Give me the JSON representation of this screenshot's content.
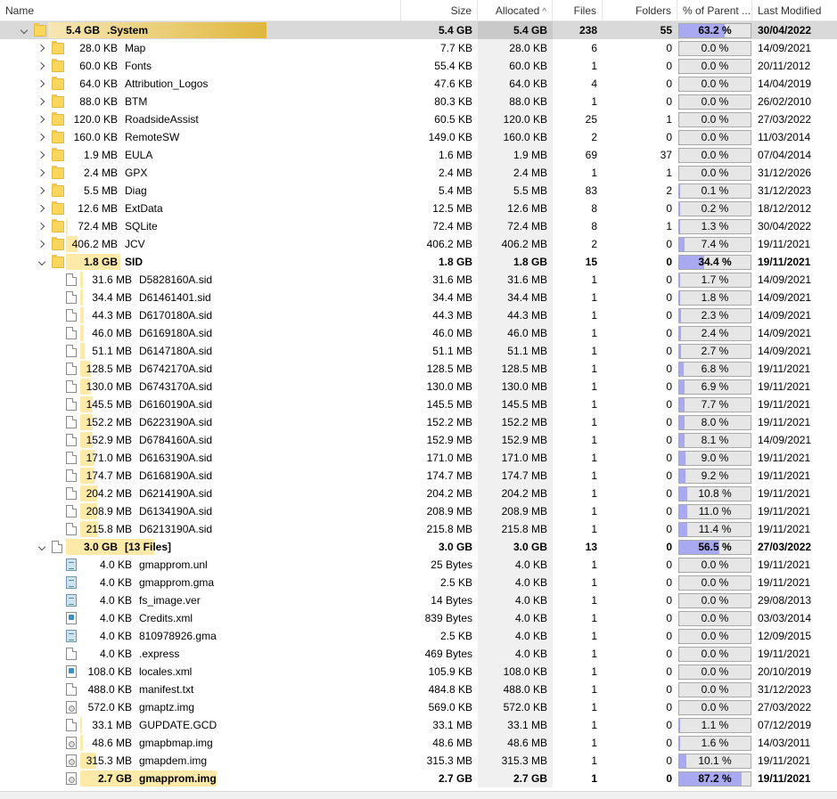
{
  "columns": {
    "name": "Name",
    "size": "Size",
    "allocated": "Allocated",
    "files": "Files",
    "folders": "Folders",
    "pct": "% of Parent ...",
    "modified": "Last Modified"
  },
  "rows": [
    {
      "depth": 0,
      "expander": "down",
      "icon": "folder-icon",
      "bar": "5.4 GB",
      "name": ".System",
      "size": "5.4 GB",
      "alloc": "5.4 GB",
      "files": "238",
      "folders": "55",
      "pct": "63.2 %",
      "pct_value": 63.2,
      "date": "30/04/2022",
      "bold": true,
      "selected": true
    },
    {
      "depth": 1,
      "expander": "right",
      "icon": "folder-icon",
      "bar": "28.0 KB",
      "name": "Map",
      "size": "7.7 KB",
      "alloc": "28.0 KB",
      "files": "6",
      "folders": "0",
      "pct": "0.0 %",
      "pct_value": 0,
      "date": "14/09/2021"
    },
    {
      "depth": 1,
      "expander": "right",
      "icon": "folder-icon",
      "bar": "60.0 KB",
      "name": "Fonts",
      "size": "55.4 KB",
      "alloc": "60.0 KB",
      "files": "1",
      "folders": "0",
      "pct": "0.0 %",
      "pct_value": 0,
      "date": "20/11/2012"
    },
    {
      "depth": 1,
      "expander": "right",
      "icon": "folder-icon",
      "bar": "64.0 KB",
      "name": "Attribution_Logos",
      "size": "47.6 KB",
      "alloc": "64.0 KB",
      "files": "4",
      "folders": "0",
      "pct": "0.0 %",
      "pct_value": 0,
      "date": "14/04/2019"
    },
    {
      "depth": 1,
      "expander": "right",
      "icon": "folder-icon",
      "bar": "88.0 KB",
      "name": "BTM",
      "size": "80.3 KB",
      "alloc": "88.0 KB",
      "files": "1",
      "folders": "0",
      "pct": "0.0 %",
      "pct_value": 0,
      "date": "26/02/2010"
    },
    {
      "depth": 1,
      "expander": "right",
      "icon": "folder-icon",
      "bar": "120.0 KB",
      "name": "RoadsideAssist",
      "size": "60.5 KB",
      "alloc": "120.0 KB",
      "files": "25",
      "folders": "1",
      "pct": "0.0 %",
      "pct_value": 0,
      "date": "27/03/2022"
    },
    {
      "depth": 1,
      "expander": "right",
      "icon": "folder-icon",
      "bar": "160.0 KB",
      "name": "RemoteSW",
      "size": "149.0 KB",
      "alloc": "160.0 KB",
      "files": "2",
      "folders": "0",
      "pct": "0.0 %",
      "pct_value": 0,
      "date": "11/03/2014"
    },
    {
      "depth": 1,
      "expander": "right",
      "icon": "folder-icon",
      "bar": "1.9 MB",
      "name": "EULA",
      "size": "1.6 MB",
      "alloc": "1.9 MB",
      "files": "69",
      "folders": "37",
      "pct": "0.0 %",
      "pct_value": 0,
      "date": "07/04/2014"
    },
    {
      "depth": 1,
      "expander": "right",
      "icon": "folder-icon",
      "bar": "2.4 MB",
      "name": "GPX",
      "size": "2.4 MB",
      "alloc": "2.4 MB",
      "files": "1",
      "folders": "1",
      "pct": "0.0 %",
      "pct_value": 0,
      "date": "31/12/2026"
    },
    {
      "depth": 1,
      "expander": "right",
      "icon": "folder-icon",
      "bar": "5.5 MB",
      "name": "Diag",
      "size": "5.4 MB",
      "alloc": "5.5 MB",
      "files": "83",
      "folders": "2",
      "pct": "0.1 %",
      "pct_value": 0.1,
      "date": "31/12/2023"
    },
    {
      "depth": 1,
      "expander": "right",
      "icon": "folder-icon",
      "bar": "12.6 MB",
      "name": "ExtData",
      "size": "12.5 MB",
      "alloc": "12.6 MB",
      "files": "8",
      "folders": "0",
      "pct": "0.2 %",
      "pct_value": 0.2,
      "date": "18/12/2012"
    },
    {
      "depth": 1,
      "expander": "right",
      "icon": "folder-icon",
      "bar": "72.4 MB",
      "name": "SQLite",
      "size": "72.4 MB",
      "alloc": "72.4 MB",
      "files": "8",
      "folders": "1",
      "pct": "1.3 %",
      "pct_value": 1.3,
      "date": "30/04/2022"
    },
    {
      "depth": 1,
      "expander": "right",
      "icon": "folder-icon",
      "bar": "406.2 MB",
      "name": "JCV",
      "size": "406.2 MB",
      "alloc": "406.2 MB",
      "files": "2",
      "folders": "0",
      "pct": "7.4 %",
      "pct_value": 7.4,
      "date": "19/11/2021"
    },
    {
      "depth": 1,
      "expander": "down",
      "icon": "folder-icon",
      "bar": "1.8 GB",
      "name": "SID",
      "size": "1.8 GB",
      "alloc": "1.8 GB",
      "files": "15",
      "folders": "0",
      "pct": "34.4 %",
      "pct_value": 34.4,
      "date": "19/11/2021",
      "bold": true
    },
    {
      "depth": 2,
      "icon": "file-icon",
      "bar": "31.6 MB",
      "name": "D5828160A.sid",
      "size": "31.6 MB",
      "alloc": "31.6 MB",
      "files": "1",
      "folders": "0",
      "pct": "1.7 %",
      "pct_value": 1.7,
      "date": "14/09/2021"
    },
    {
      "depth": 2,
      "icon": "file-icon",
      "bar": "34.4 MB",
      "name": "D61461401.sid",
      "size": "34.4 MB",
      "alloc": "34.4 MB",
      "files": "1",
      "folders": "0",
      "pct": "1.8 %",
      "pct_value": 1.8,
      "date": "14/09/2021"
    },
    {
      "depth": 2,
      "icon": "file-icon",
      "bar": "44.3 MB",
      "name": "D6170180A.sid",
      "size": "44.3 MB",
      "alloc": "44.3 MB",
      "files": "1",
      "folders": "0",
      "pct": "2.3 %",
      "pct_value": 2.3,
      "date": "14/09/2021"
    },
    {
      "depth": 2,
      "icon": "file-icon",
      "bar": "46.0 MB",
      "name": "D6169180A.sid",
      "size": "46.0 MB",
      "alloc": "46.0 MB",
      "files": "1",
      "folders": "0",
      "pct": "2.4 %",
      "pct_value": 2.4,
      "date": "14/09/2021"
    },
    {
      "depth": 2,
      "icon": "file-icon",
      "bar": "51.1 MB",
      "name": "D6147180A.sid",
      "size": "51.1 MB",
      "alloc": "51.1 MB",
      "files": "1",
      "folders": "0",
      "pct": "2.7 %",
      "pct_value": 2.7,
      "date": "14/09/2021"
    },
    {
      "depth": 2,
      "icon": "file-icon",
      "bar": "128.5 MB",
      "name": "D6742170A.sid",
      "size": "128.5 MB",
      "alloc": "128.5 MB",
      "files": "1",
      "folders": "0",
      "pct": "6.8 %",
      "pct_value": 6.8,
      "date": "19/11/2021"
    },
    {
      "depth": 2,
      "icon": "file-icon",
      "bar": "130.0 MB",
      "name": "D6743170A.sid",
      "size": "130.0 MB",
      "alloc": "130.0 MB",
      "files": "1",
      "folders": "0",
      "pct": "6.9 %",
      "pct_value": 6.9,
      "date": "19/11/2021"
    },
    {
      "depth": 2,
      "icon": "file-icon",
      "bar": "145.5 MB",
      "name": "D6160190A.sid",
      "size": "145.5 MB",
      "alloc": "145.5 MB",
      "files": "1",
      "folders": "0",
      "pct": "7.7 %",
      "pct_value": 7.7,
      "date": "19/11/2021"
    },
    {
      "depth": 2,
      "icon": "file-icon",
      "bar": "152.2 MB",
      "name": "D6223190A.sid",
      "size": "152.2 MB",
      "alloc": "152.2 MB",
      "files": "1",
      "folders": "0",
      "pct": "8.0 %",
      "pct_value": 8.0,
      "date": "19/11/2021"
    },
    {
      "depth": 2,
      "icon": "file-icon",
      "bar": "152.9 MB",
      "name": "D6784160A.sid",
      "size": "152.9 MB",
      "alloc": "152.9 MB",
      "files": "1",
      "folders": "0",
      "pct": "8.1 %",
      "pct_value": 8.1,
      "date": "14/09/2021"
    },
    {
      "depth": 2,
      "icon": "file-icon",
      "bar": "171.0 MB",
      "name": "D6163190A.sid",
      "size": "171.0 MB",
      "alloc": "171.0 MB",
      "files": "1",
      "folders": "0",
      "pct": "9.0 %",
      "pct_value": 9.0,
      "date": "19/11/2021"
    },
    {
      "depth": 2,
      "icon": "file-icon",
      "bar": "174.7 MB",
      "name": "D6168190A.sid",
      "size": "174.7 MB",
      "alloc": "174.7 MB",
      "files": "1",
      "folders": "0",
      "pct": "9.2 %",
      "pct_value": 9.2,
      "date": "19/11/2021"
    },
    {
      "depth": 2,
      "icon": "file-icon",
      "bar": "204.2 MB",
      "name": "D6214190A.sid",
      "size": "204.2 MB",
      "alloc": "204.2 MB",
      "files": "1",
      "folders": "0",
      "pct": "10.8 %",
      "pct_value": 10.8,
      "date": "19/11/2021"
    },
    {
      "depth": 2,
      "icon": "file-icon",
      "bar": "208.9 MB",
      "name": "D6134190A.sid",
      "size": "208.9 MB",
      "alloc": "208.9 MB",
      "files": "1",
      "folders": "0",
      "pct": "11.0 %",
      "pct_value": 11.0,
      "date": "19/11/2021"
    },
    {
      "depth": 2,
      "icon": "file-icon",
      "bar": "215.8 MB",
      "name": "D6213190A.sid",
      "size": "215.8 MB",
      "alloc": "215.8 MB",
      "files": "1",
      "folders": "0",
      "pct": "11.4 %",
      "pct_value": 11.4,
      "date": "19/11/2021"
    },
    {
      "depth": 1,
      "expander": "down",
      "icon": "file-icon",
      "bar": "3.0 GB",
      "name": "[13 Files]",
      "size": "3.0 GB",
      "alloc": "3.0 GB",
      "files": "13",
      "folders": "0",
      "pct": "56.5 %",
      "pct_value": 56.5,
      "date": "27/03/2022",
      "bold": true
    },
    {
      "depth": 2,
      "icon": "doc-icon",
      "bar": "4.0 KB",
      "name": "gmapprom.unl",
      "size": "25 Bytes",
      "alloc": "4.0 KB",
      "files": "1",
      "folders": "0",
      "pct": "0.0 %",
      "pct_value": 0,
      "date": "19/11/2021"
    },
    {
      "depth": 2,
      "icon": "doc-icon",
      "bar": "4.0 KB",
      "name": "gmapprom.gma",
      "size": "2.5 KB",
      "alloc": "4.0 KB",
      "files": "1",
      "folders": "0",
      "pct": "0.0 %",
      "pct_value": 0,
      "date": "19/11/2021"
    },
    {
      "depth": 2,
      "icon": "doc-icon",
      "bar": "4.0 KB",
      "name": "fs_image.ver",
      "size": "14 Bytes",
      "alloc": "4.0 KB",
      "files": "1",
      "folders": "0",
      "pct": "0.0 %",
      "pct_value": 0,
      "date": "29/08/2013"
    },
    {
      "depth": 2,
      "icon": "xml-icon",
      "bar": "4.0 KB",
      "name": "Credits.xml",
      "size": "839 Bytes",
      "alloc": "4.0 KB",
      "files": "1",
      "folders": "0",
      "pct": "0.0 %",
      "pct_value": 0,
      "date": "03/03/2014"
    },
    {
      "depth": 2,
      "icon": "doc-icon",
      "bar": "4.0 KB",
      "name": "810978926.gma",
      "size": "2.5 KB",
      "alloc": "4.0 KB",
      "files": "1",
      "folders": "0",
      "pct": "0.0 %",
      "pct_value": 0,
      "date": "12/09/2015"
    },
    {
      "depth": 2,
      "icon": "file-icon",
      "bar": "4.0 KB",
      "name": ".express",
      "size": "469 Bytes",
      "alloc": "4.0 KB",
      "files": "1",
      "folders": "0",
      "pct": "0.0 %",
      "pct_value": 0,
      "date": "19/11/2021"
    },
    {
      "depth": 2,
      "icon": "xml-icon",
      "bar": "108.0 KB",
      "name": "locales.xml",
      "size": "105.9 KB",
      "alloc": "108.0 KB",
      "files": "1",
      "folders": "0",
      "pct": "0.0 %",
      "pct_value": 0,
      "date": "20/10/2019"
    },
    {
      "depth": 2,
      "icon": "file-icon",
      "bar": "488.0 KB",
      "name": "manifest.txt",
      "size": "484.8 KB",
      "alloc": "488.0 KB",
      "files": "1",
      "folders": "0",
      "pct": "0.0 %",
      "pct_value": 0,
      "date": "31/12/2023"
    },
    {
      "depth": 2,
      "icon": "cog-icon",
      "bar": "572.0 KB",
      "name": "gmaptz.img",
      "size": "569.0 KB",
      "alloc": "572.0 KB",
      "files": "1",
      "folders": "0",
      "pct": "0.0 %",
      "pct_value": 0,
      "date": "27/03/2022"
    },
    {
      "depth": 2,
      "icon": "file-icon",
      "bar": "33.1 MB",
      "name": "GUPDATE.GCD",
      "size": "33.1 MB",
      "alloc": "33.1 MB",
      "files": "1",
      "folders": "0",
      "pct": "1.1 %",
      "pct_value": 1.1,
      "date": "07/12/2019"
    },
    {
      "depth": 2,
      "icon": "cog-icon",
      "bar": "48.6 MB",
      "name": "gmapbmap.img",
      "size": "48.6 MB",
      "alloc": "48.6 MB",
      "files": "1",
      "folders": "0",
      "pct": "1.6 %",
      "pct_value": 1.6,
      "date": "14/03/2011"
    },
    {
      "depth": 2,
      "icon": "cog-icon",
      "bar": "315.3 MB",
      "name": "gmapdem.img",
      "size": "315.3 MB",
      "alloc": "315.3 MB",
      "files": "1",
      "folders": "0",
      "pct": "10.1 %",
      "pct_value": 10.1,
      "date": "19/11/2021"
    },
    {
      "depth": 2,
      "icon": "cog-icon",
      "bar": "2.7 GB",
      "name": "gmapprom.img",
      "size": "2.7 GB",
      "alloc": "2.7 GB",
      "files": "1",
      "folders": "0",
      "pct": "87.2 %",
      "pct_value": 87.2,
      "date": "19/11/2021",
      "bold": true
    }
  ],
  "colors": {
    "pct_fill": "#a9a9f2",
    "pct_bg": "#e6e6e6",
    "size_bar": "#fde9a8",
    "folder": "#f9d75c",
    "selection": "#d9d9d9"
  }
}
